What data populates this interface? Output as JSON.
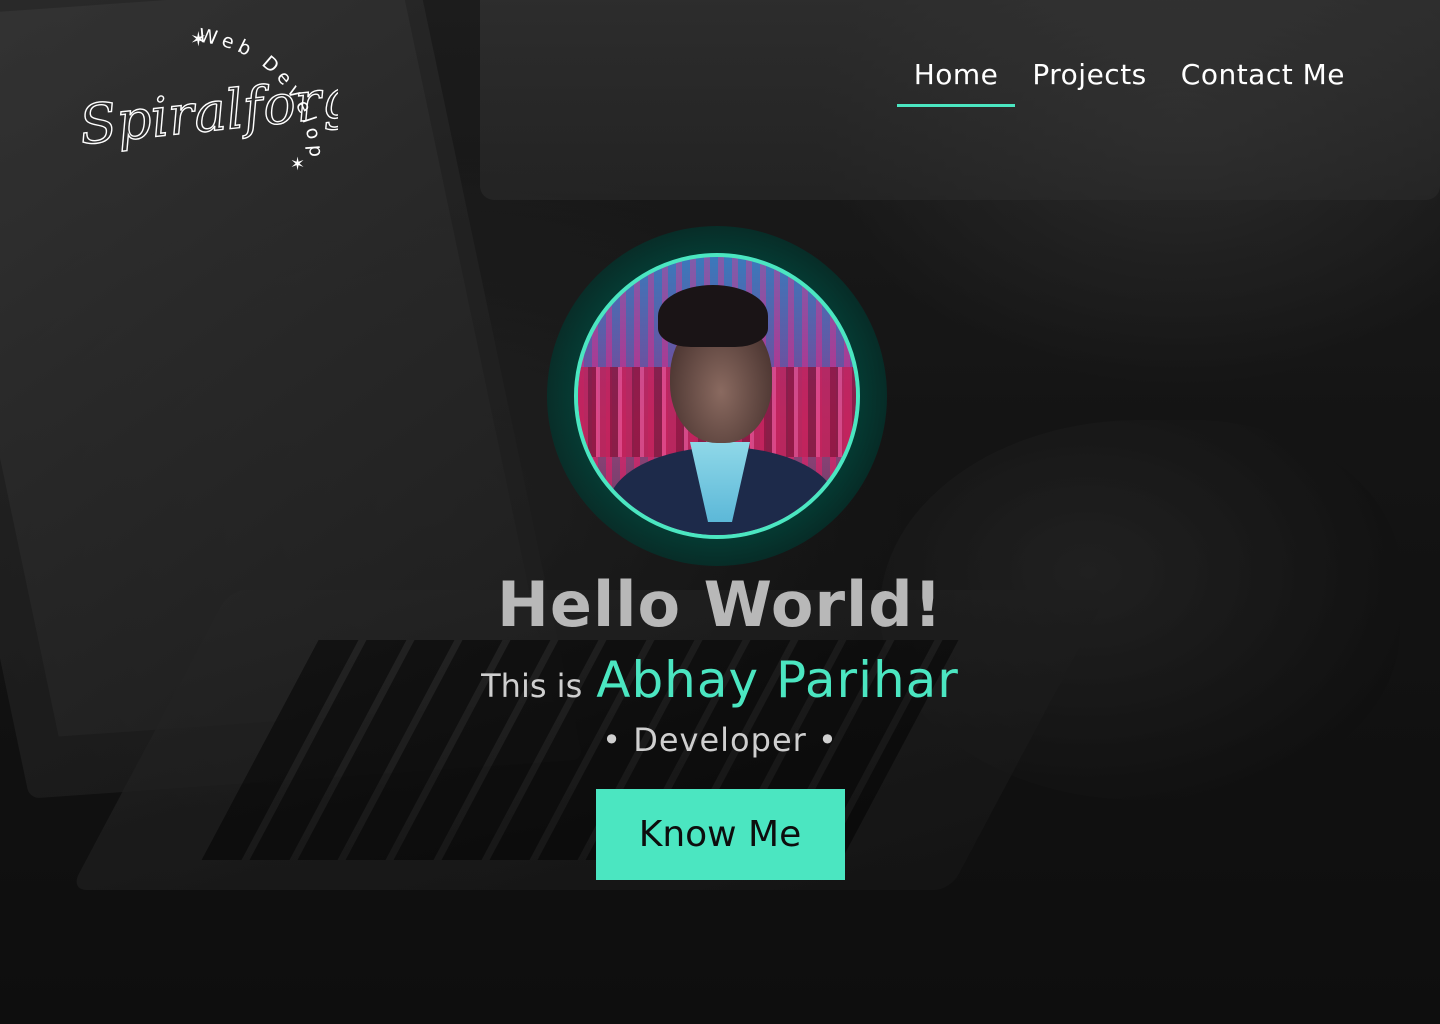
{
  "logo": {
    "script_text": "Spiralforge",
    "arc_text": "Web Developer"
  },
  "nav": {
    "items": [
      {
        "label": "Home",
        "active": true
      },
      {
        "label": "Projects",
        "active": false
      },
      {
        "label": "Contact Me",
        "active": false
      }
    ]
  },
  "hero": {
    "greeting": "Hello World!",
    "intro_prefix": "This is",
    "name": "Abhay Parihar",
    "role": "• Developer •",
    "cta_label": "Know Me"
  },
  "colors": {
    "accent": "#4be6c1",
    "greeting_text": "#b8b8b8",
    "body_text": "#cfcfcf"
  }
}
